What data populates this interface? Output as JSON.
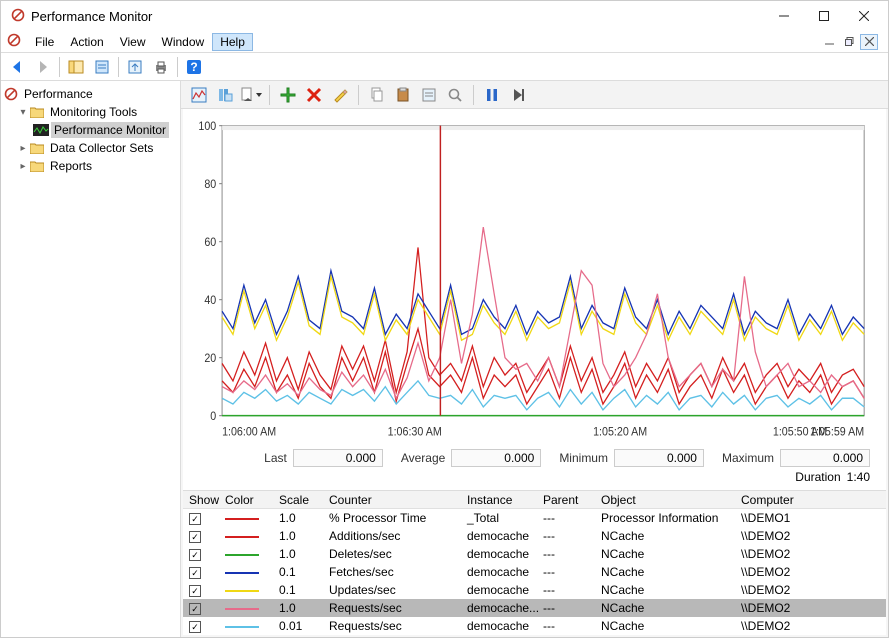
{
  "window": {
    "title": "Performance Monitor"
  },
  "menu": {
    "file": "File",
    "action": "Action",
    "view": "View",
    "window": "Window",
    "help": "Help"
  },
  "tree": {
    "root": "Performance",
    "monitoring_tools": "Monitoring Tools",
    "performance_monitor": "Performance Monitor",
    "data_collector_sets": "Data Collector Sets",
    "reports": "Reports"
  },
  "chart_data": {
    "type": "line",
    "xlabel": "",
    "ylabel": "",
    "ylim": [
      0,
      100
    ],
    "yticks": [
      0,
      20,
      40,
      60,
      80,
      100
    ],
    "xticks": [
      "1:06:00 AM",
      "1:06:30 AM",
      "1:05:20 AM",
      "1:05:50 AM",
      "1:05:59 AM"
    ],
    "xtick_pos": [
      0,
      0.3,
      0.62,
      0.9,
      1.0
    ],
    "cursor_x": 0.34,
    "series": [
      {
        "name": "% Processor Time",
        "color": "#d41f1f",
        "values_scaled": [
          18,
          12,
          22,
          14,
          25,
          12,
          20,
          9,
          22,
          14,
          9,
          24,
          16,
          24,
          12,
          26,
          8,
          22,
          58,
          20,
          14,
          18,
          12,
          24,
          10,
          20,
          14,
          18,
          8,
          14,
          20,
          10,
          24,
          12,
          20,
          8,
          14,
          22,
          10,
          18,
          12,
          20,
          8,
          14,
          18,
          10,
          20,
          12,
          18,
          8,
          14,
          18,
          10,
          16,
          12,
          18,
          8,
          14,
          16,
          10
        ]
      },
      {
        "name": "Additions/sec",
        "color": "#d41f1f",
        "values_scaled": [
          12,
          8,
          16,
          10,
          20,
          8,
          14,
          6,
          18,
          10,
          6,
          20,
          12,
          20,
          8,
          22,
          5,
          18,
          30,
          14,
          10,
          14,
          8,
          20,
          6,
          14,
          10,
          14,
          4,
          10,
          16,
          6,
          20,
          8,
          16,
          4,
          10,
          18,
          6,
          14,
          8,
          16,
          4,
          10,
          14,
          6,
          16,
          8,
          14,
          4,
          10,
          14,
          6,
          12,
          8,
          14,
          4,
          10,
          12,
          6
        ]
      },
      {
        "name": "Deletes/sec",
        "color": "#2ca52c",
        "values_scaled": [
          0,
          0,
          0,
          0,
          0,
          0,
          0,
          0,
          0,
          0,
          0,
          0,
          0,
          0,
          0,
          0,
          0,
          0,
          0,
          0,
          0,
          0,
          0,
          0,
          0,
          0,
          0,
          0,
          0,
          0,
          0,
          0,
          0,
          0,
          0,
          0,
          0,
          0,
          0,
          0,
          0,
          0,
          0,
          0,
          0,
          0,
          0,
          0,
          0,
          0,
          0,
          0,
          0,
          0,
          0,
          0,
          0,
          0,
          0,
          0
        ]
      },
      {
        "name": "Fetches/sec",
        "color": "#1634b3",
        "values_scaled": [
          36,
          30,
          45,
          32,
          40,
          28,
          36,
          48,
          33,
          30,
          50,
          36,
          34,
          30,
          44,
          28,
          35,
          30,
          42,
          36,
          30,
          45,
          28,
          30,
          40,
          34,
          30,
          38,
          28,
          36,
          32,
          34,
          48,
          30,
          38,
          32,
          30,
          44,
          34,
          30,
          40,
          28,
          36,
          30,
          38,
          34,
          30,
          42,
          28,
          36,
          32,
          30,
          40,
          28,
          35,
          30,
          38,
          28,
          34,
          30
        ]
      },
      {
        "name": "Updates/sec",
        "color": "#f0d814",
        "values_scaled": [
          34,
          28,
          43,
          30,
          38,
          26,
          34,
          46,
          31,
          28,
          48,
          34,
          32,
          28,
          42,
          26,
          33,
          28,
          40,
          34,
          28,
          43,
          26,
          28,
          38,
          32,
          28,
          36,
          26,
          34,
          30,
          32,
          46,
          28,
          36,
          30,
          28,
          42,
          32,
          28,
          38,
          26,
          34,
          28,
          36,
          32,
          28,
          40,
          26,
          34,
          30,
          28,
          38,
          26,
          33,
          28,
          36,
          26,
          32,
          28
        ]
      },
      {
        "name": "Requests/sec (1.0)",
        "color": "#e66b8a",
        "values_scaled": [
          10,
          8,
          12,
          9,
          14,
          8,
          11,
          7,
          13,
          9,
          7,
          15,
          10,
          14,
          8,
          16,
          6,
          13,
          25,
          12,
          20,
          40,
          18,
          35,
          65,
          42,
          20,
          16,
          18,
          12,
          20,
          10,
          30,
          50,
          45,
          18,
          10,
          14,
          20,
          28,
          42,
          20,
          10,
          14,
          18,
          10,
          16,
          12,
          48,
          22,
          10,
          14,
          18,
          10,
          12,
          8,
          14,
          10,
          12,
          6
        ]
      },
      {
        "name": "Requests/sec (0.01)",
        "color": "#5ec1e6",
        "values_scaled": [
          6,
          4,
          8,
          6,
          9,
          5,
          7,
          4,
          8,
          6,
          4,
          9,
          7,
          9,
          5,
          10,
          4,
          8,
          12,
          7,
          6,
          7,
          4,
          9,
          3,
          7,
          6,
          7,
          2,
          6,
          8,
          3,
          9,
          4,
          8,
          2,
          6,
          9,
          3,
          7,
          4,
          8,
          2,
          6,
          7,
          3,
          8,
          4,
          7,
          2,
          6,
          7,
          3,
          6,
          4,
          7,
          2,
          6,
          6,
          3
        ]
      }
    ]
  },
  "stats": {
    "last_label": "Last",
    "last": "0.000",
    "avg_label": "Average",
    "avg": "0.000",
    "min_label": "Minimum",
    "min": "0.000",
    "max_label": "Maximum",
    "max": "0.000",
    "duration_label": "Duration",
    "duration": "1:40"
  },
  "grid": {
    "headers": {
      "show": "Show",
      "color": "Color",
      "scale": "Scale",
      "counter": "Counter",
      "instance": "Instance",
      "parent": "Parent",
      "object": "Object",
      "computer": "Computer"
    },
    "rows": [
      {
        "checked": true,
        "color": "#d41f1f",
        "scale": "1.0",
        "counter": "% Processor Time",
        "instance": "_Total",
        "parent": "---",
        "object": "Processor Information",
        "computer": "\\\\DEMO1",
        "selected": false
      },
      {
        "checked": true,
        "color": "#d41f1f",
        "scale": "1.0",
        "counter": "Additions/sec",
        "instance": "democache",
        "parent": "---",
        "object": "NCache",
        "computer": "\\\\DEMO2",
        "selected": false
      },
      {
        "checked": true,
        "color": "#2ca52c",
        "scale": "1.0",
        "counter": "Deletes/sec",
        "instance": "democache",
        "parent": "---",
        "object": "NCache",
        "computer": "\\\\DEMO2",
        "selected": false
      },
      {
        "checked": true,
        "color": "#1634b3",
        "scale": "0.1",
        "counter": "Fetches/sec",
        "instance": "democache",
        "parent": "---",
        "object": "NCache",
        "computer": "\\\\DEMO2",
        "selected": false
      },
      {
        "checked": true,
        "color": "#f0d814",
        "scale": "0.1",
        "counter": "Updates/sec",
        "instance": "democache",
        "parent": "---",
        "object": "NCache",
        "computer": "\\\\DEMO2",
        "selected": false
      },
      {
        "checked": true,
        "color": "#e66b8a",
        "scale": "1.0",
        "counter": "Requests/sec",
        "instance": "democache...",
        "parent": "---",
        "object": "NCache",
        "computer": "\\\\DEMO2",
        "selected": true
      },
      {
        "checked": true,
        "color": "#5ec1e6",
        "scale": "0.01",
        "counter": "Requests/sec",
        "instance": "democache",
        "parent": "---",
        "object": "NCache",
        "computer": "\\\\DEMO2",
        "selected": false
      }
    ]
  }
}
